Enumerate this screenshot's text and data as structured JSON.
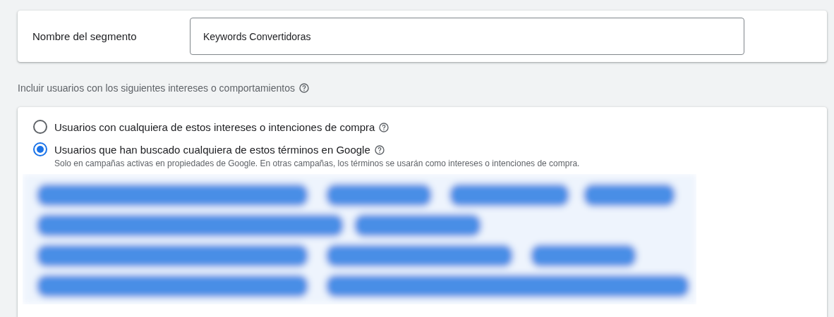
{
  "segment_name": {
    "label": "Nombre del segmento",
    "value": "Keywords Convertidoras"
  },
  "section_label": "Incluir usuarios con los siguientes intereses o comportamientos",
  "options": [
    {
      "label": "Usuarios con cualquiera de estos intereses o intenciones de compra",
      "selected": false
    },
    {
      "label": "Usuarios que han buscado cualquiera de estos términos en Google",
      "selected": true,
      "note": "Solo en campañas activas en propiedades de Google. En otras campañas, los términos se usarán como intereses o intenciones de compra."
    }
  ]
}
